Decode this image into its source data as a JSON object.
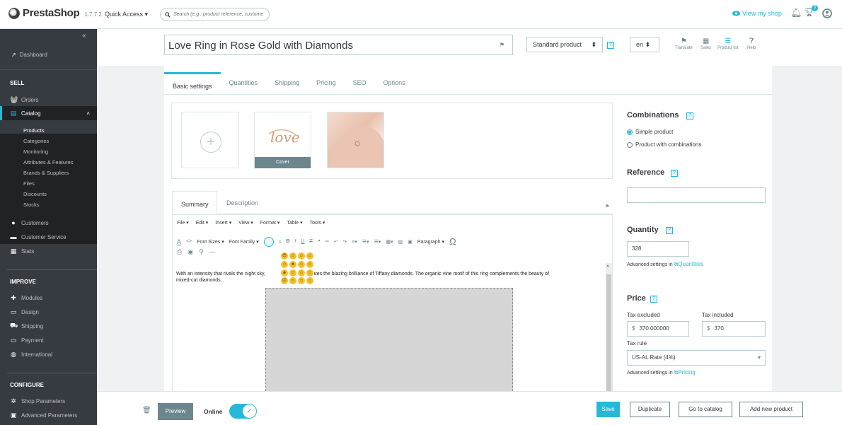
{
  "topbar": {
    "brand": "PrestaShop",
    "version": "1.7.7.2",
    "quick_access": "Quick Access ▾",
    "search_placeholder": "Search (e.g.: product reference, custome",
    "view_shop": "View my shop",
    "notifications_count": "5"
  },
  "sidebar": {
    "dashboard": "Dashboard",
    "sell_title": "SELL",
    "sell_items": [
      "Orders",
      "Catalog",
      "Customers",
      "Customer Service",
      "Stats"
    ],
    "catalog_sub": [
      "Products",
      "Categories",
      "Monitoring",
      "Attributes & Features",
      "Brands & Suppliers",
      "Files",
      "Discounts",
      "Stocks"
    ],
    "improve_title": "IMPROVE",
    "improve_items": [
      "Modules",
      "Design",
      "Shipping",
      "Payment",
      "International"
    ],
    "configure_title": "CONFIGURE",
    "configure_items": [
      "Shop Parameters",
      "Advanced Parameters"
    ]
  },
  "header": {
    "product_name": "Love Ring in Rose Gold with Diamonds",
    "product_type": "Standard product",
    "language": "en",
    "actions": [
      "Translate",
      "Sales",
      "Product list",
      "Help"
    ]
  },
  "tabs": [
    "Basic settings",
    "Quantities",
    "Shipping",
    "Pricing",
    "SEO",
    "Options"
  ],
  "images": {
    "cover_label": "Cover",
    "ring_text": "love"
  },
  "editor": {
    "tabs": [
      "Summary",
      "Description"
    ],
    "menu": [
      "File ▾",
      "Edit ▾",
      "Insert ▾",
      "View ▾",
      "Format ▾",
      "Table ▾",
      "Tools ▾"
    ],
    "toolbar": {
      "font_sizes": "Font Sizes ▾",
      "font_family": "Font Family ▾",
      "paragraph": "Paragraph ▾"
    },
    "text_before": "With an intensity that rivals the night sky,",
    "text_after": "celebrates the blazing brilliance of Tiffany diamonds. The organic vine motif of this ring complements the beauty of",
    "text_line2": "mixed-cut diamonds."
  },
  "right": {
    "combinations_title": "Combinations",
    "simple_product": "Simple product",
    "with_combinations": "Product with combinations",
    "reference_title": "Reference",
    "reference_value": "",
    "quantity_title": "Quantity",
    "quantity_value": "328",
    "adv_quantities_prefix": "Advanced settings in",
    "adv_quantities_link": "Quantities",
    "price_title": "Price",
    "tax_excluded_label": "Tax excluded",
    "tax_included_label": "Tax included",
    "currency": "$",
    "tax_excluded_value": "370.000000",
    "tax_included_value": "370",
    "tax_rule_label": "Tax rule",
    "tax_rule_value": "US-AL Rate (4%)",
    "adv_pricing_prefix": "Advanced settings in",
    "adv_pricing_link": "Pricing"
  },
  "bottom": {
    "preview": "Preview",
    "online": "Online",
    "save": "Save",
    "duplicate": "Duplicate",
    "go_to_catalog": "Go to catalog",
    "add_new_product": "Add new product"
  },
  "colors": {
    "accent": "#25b9d7",
    "sidebar": "#363a41",
    "sidebar_active": "#202226"
  }
}
